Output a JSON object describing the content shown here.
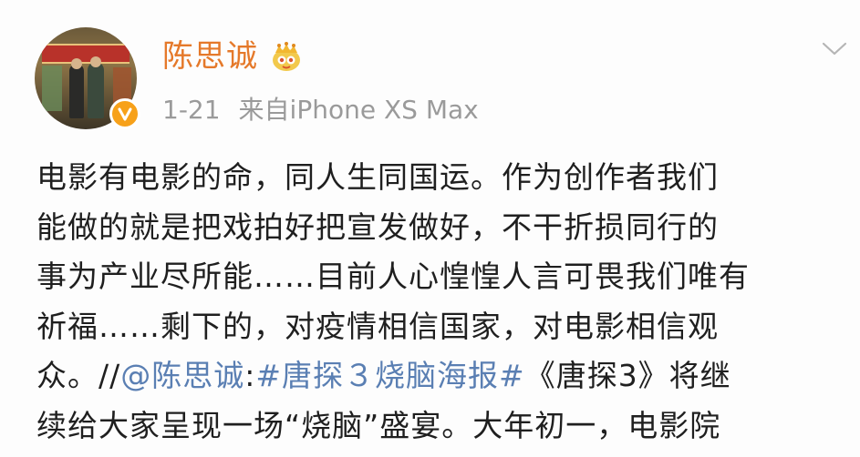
{
  "post": {
    "author": {
      "name": "陈思诚",
      "avatar_icon": "movie-poster-avatar",
      "verified_icon": "verified-v-icon",
      "vip_icon": "vip-crown-icon"
    },
    "meta": {
      "time": "1-21",
      "source": "来自iPhone XS Max"
    },
    "menu_icon": "chevron-down-icon",
    "content_lines": {
      "l1": "电影有电影的命，同人生同国运。作为创作者我们",
      "l2": "能做的就是把戏拍好把宣发做好，不干折损同行的",
      "l3": "事为产业尽所能……目前人心惶惶人言可畏我们唯有",
      "l4": "祈福……剩下的，对疫情相信国家，对电影相信观",
      "l5_pre": "众。//",
      "l5_mention": "@陈思诚",
      "l5_colon": ":",
      "l5_hashtag": "#唐探３烧脑海报#",
      "l5_post": "《唐探3》将继",
      "l6": "续给大家呈现一场“烧脑”盛宴。大年初一，电影院"
    },
    "colors": {
      "username": "#e5792a",
      "link": "#5a7fb3",
      "meta": "#9a9a9a",
      "text": "#1f1f1f",
      "badge": "#f7a11a"
    }
  }
}
